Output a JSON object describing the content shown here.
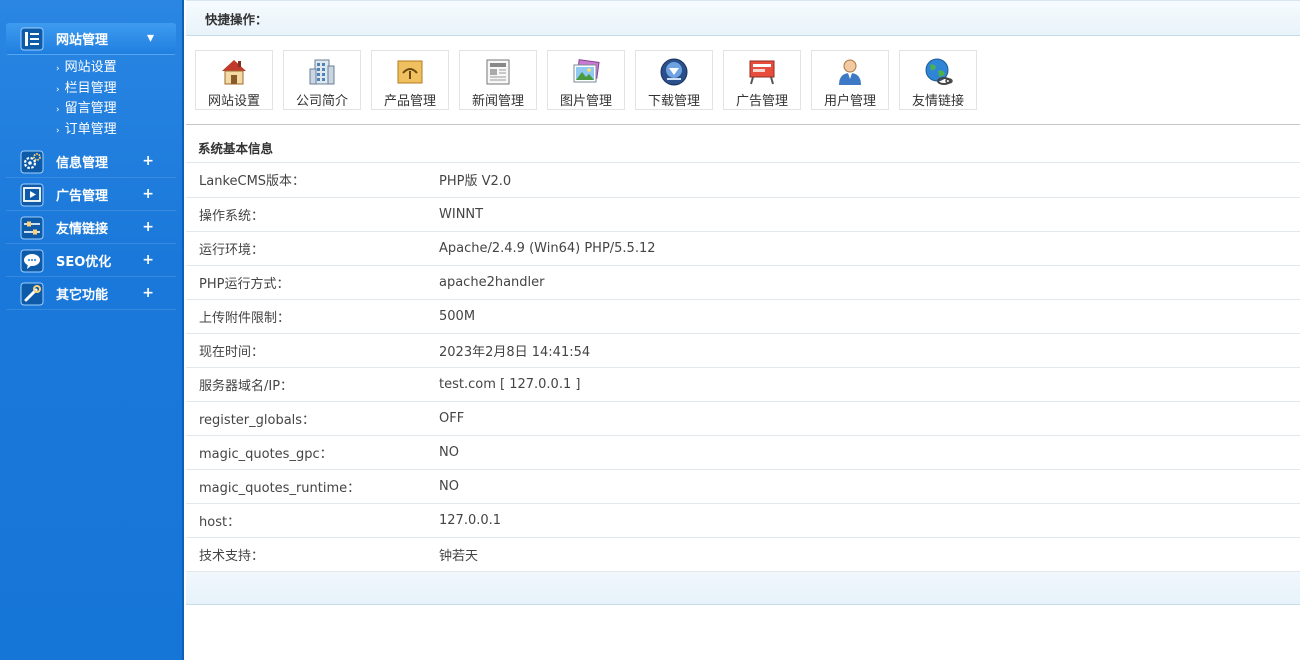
{
  "sidebar": {
    "groups": [
      {
        "label": "网站管理",
        "toggle": "▾",
        "icon": "list-icon",
        "items": [
          "网站设置",
          "栏目管理",
          "留言管理",
          "订单管理"
        ]
      },
      {
        "label": "信息管理",
        "toggle": "+",
        "icon": "gears-icon"
      },
      {
        "label": "广告管理",
        "toggle": "+",
        "icon": "play-screen-icon"
      },
      {
        "label": "友情链接",
        "toggle": "+",
        "icon": "sliders-icon"
      },
      {
        "label": "SEO优化",
        "toggle": "+",
        "icon": "chat-bubble-icon"
      },
      {
        "label": "其它功能",
        "toggle": "+",
        "icon": "wrench-icon"
      }
    ],
    "colors": {
      "background": "#1a78da",
      "border": "#0f5fb8"
    }
  },
  "quick": {
    "title": "快捷操作：",
    "items": [
      {
        "label": "网站设置",
        "icon": "house-icon"
      },
      {
        "label": "公司简介",
        "icon": "building-icon"
      },
      {
        "label": "产品管理",
        "icon": "product-box-icon"
      },
      {
        "label": "新闻管理",
        "icon": "newspaper-icon"
      },
      {
        "label": "图片管理",
        "icon": "picture-icon"
      },
      {
        "label": "下载管理",
        "icon": "download-icon"
      },
      {
        "label": "广告管理",
        "icon": "billboard-icon"
      },
      {
        "label": "用户管理",
        "icon": "user-icon"
      },
      {
        "label": "友情链接",
        "icon": "globe-link-icon"
      }
    ]
  },
  "info": {
    "title": "系统基本信息",
    "rows": [
      {
        "k": "LankeCMS版本：",
        "v": "PHP版 V2.0"
      },
      {
        "k": "操作系统：",
        "v": "WINNT"
      },
      {
        "k": "运行环境：",
        "v": "Apache/2.4.9 (Win64) PHP/5.5.12"
      },
      {
        "k": "PHP运行方式：",
        "v": "apache2handler"
      },
      {
        "k": "上传附件限制：",
        "v": "500M"
      },
      {
        "k": "现在时间：",
        "v": "2023年2月8日 14:41:54"
      },
      {
        "k": "服务器域名/IP：",
        "v": "test.com [ 127.0.0.1 ]"
      },
      {
        "k": "register_globals：",
        "v": "OFF"
      },
      {
        "k": "magic_quotes_gpc：",
        "v": "NO"
      },
      {
        "k": "magic_quotes_runtime：",
        "v": "NO"
      },
      {
        "k": "host：",
        "v": "127.0.0.1"
      },
      {
        "k": "技术支持：",
        "v": "钟若天"
      }
    ]
  }
}
